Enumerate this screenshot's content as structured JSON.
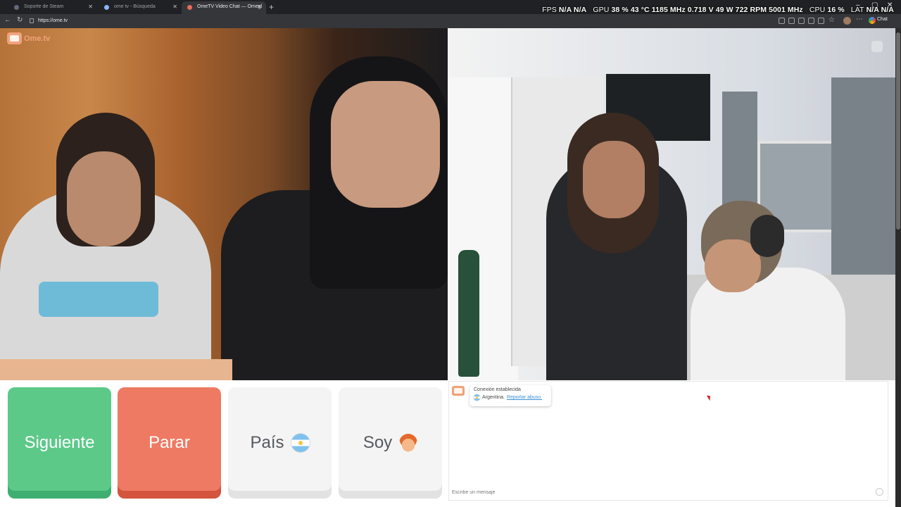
{
  "browser": {
    "tabs": [
      {
        "title": "Soporte de Steam",
        "active": false
      },
      {
        "title": "ome tv - Búsqueda",
        "active": false
      },
      {
        "title": "OmeTV Video Chat — Omegl",
        "active": true
      }
    ],
    "url": "https://ome.tv",
    "chat_button": "Chat"
  },
  "overlay": {
    "fps_label": "FPS",
    "fps": "N/A  N/A",
    "gpu_label": "GPU",
    "gpu": "38 %  43 °C  1185 MHz  0.718 V  49 W  722 RPM  5001 MHz",
    "cpu_label": "CPU",
    "cpu": "16 %",
    "lat_label": "LAT",
    "lat": "N/A  N/A"
  },
  "site": {
    "logo_text": "Ome.tv"
  },
  "controls": {
    "next_label": "Siguiente",
    "stop_label": "Parar",
    "country_label": "País",
    "me_label": "Soy"
  },
  "chat": {
    "status": "Conexión establecida",
    "country": "Argentina.",
    "report_link": "Reportar abuso.",
    "input_placeholder": "Escribe un mensaje"
  },
  "colors": {
    "next": "#5cc989",
    "stop": "#ee7a63",
    "neutral": "#f4f4f4",
    "link": "#3a8fd6"
  }
}
